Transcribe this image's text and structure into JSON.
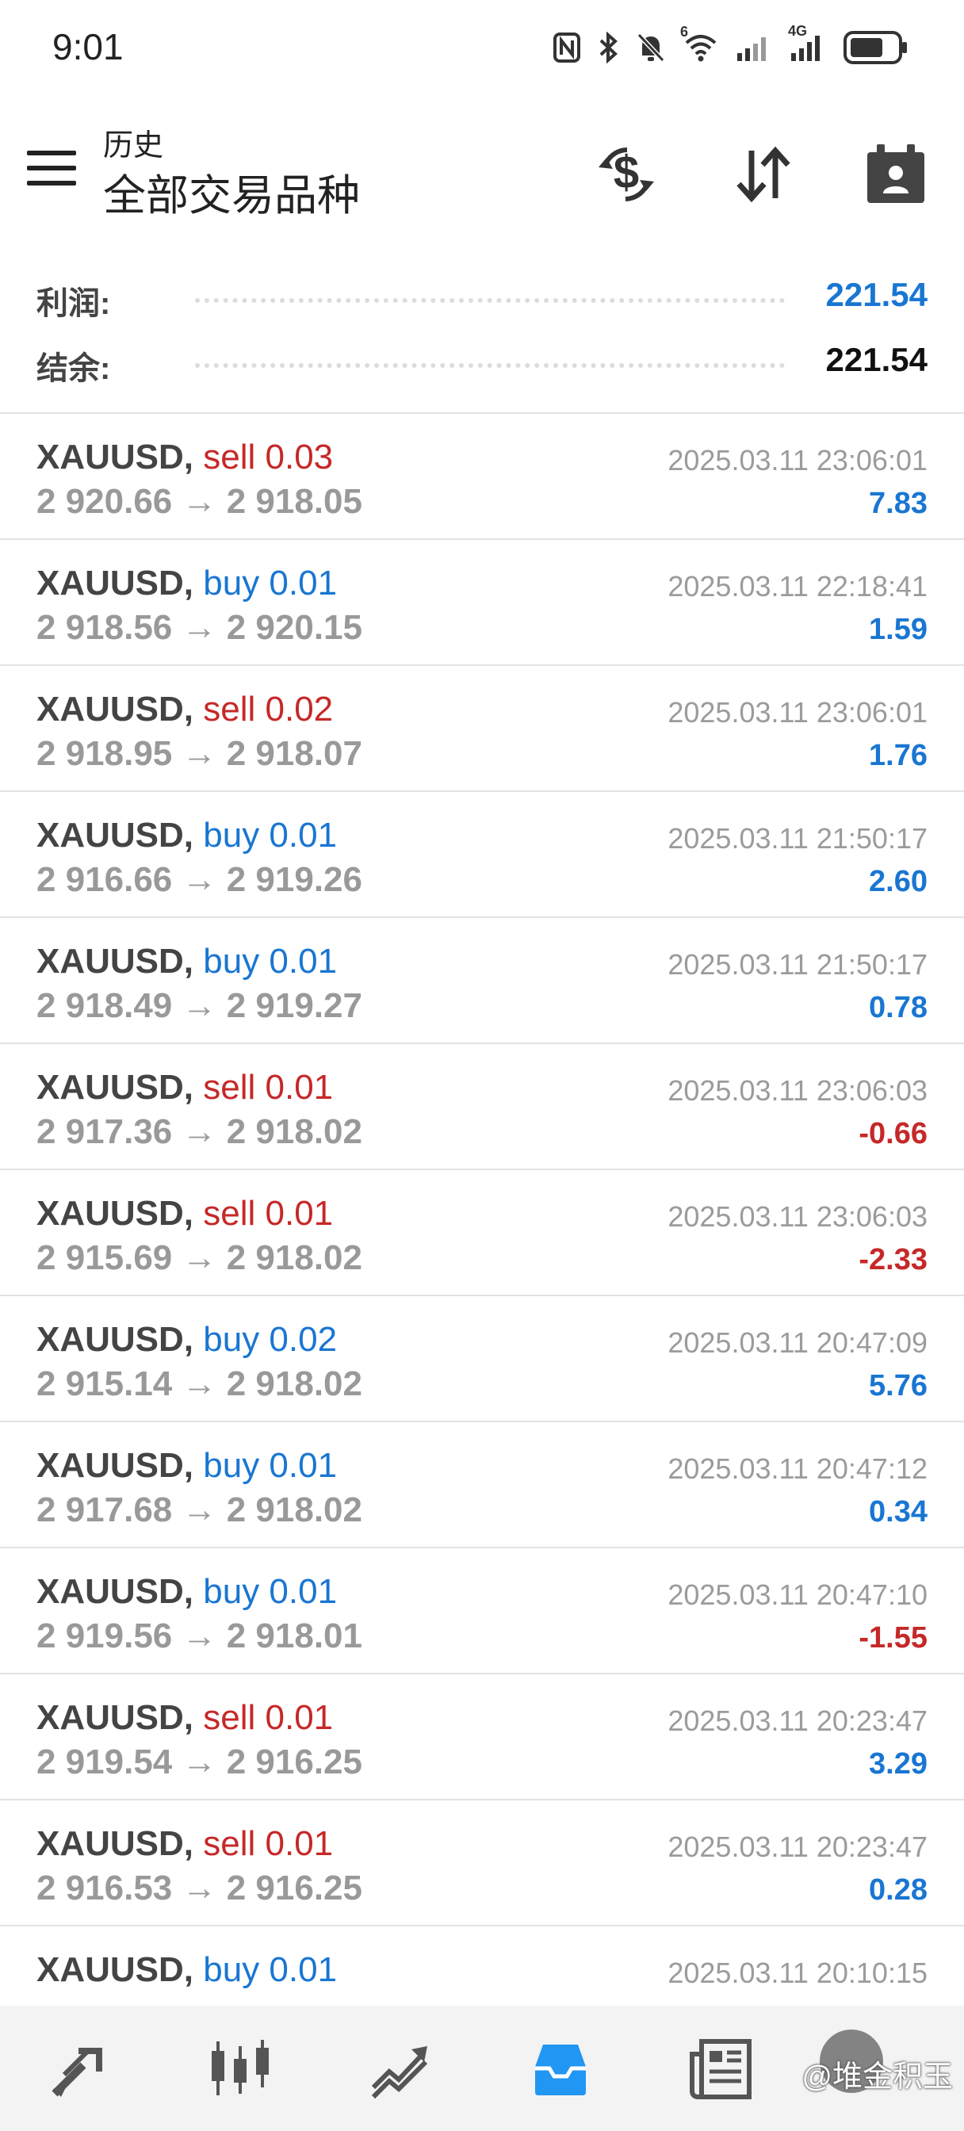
{
  "status_bar": {
    "time": "9:01",
    "icons": [
      "nfc-icon",
      "bluetooth-icon",
      "mute-icon",
      "wifi-icon",
      "signal-icon",
      "signal-4g-icon",
      "battery-icon"
    ],
    "wifi_label": "6",
    "network_label": "4G"
  },
  "header": {
    "subtitle": "历史",
    "title": "全部交易品种",
    "icons": [
      "menu-icon",
      "deposit-icon",
      "sort-icon",
      "calendar-icon"
    ]
  },
  "summary": {
    "profit_label": "利润:",
    "profit_value": "221.54",
    "balance_label": "结余:",
    "balance_value": "221.54"
  },
  "colors": {
    "buy": "#1976d2",
    "sell": "#c62828",
    "positive": "#1976d2",
    "negative": "#c62828",
    "accent_active": "#2196f3"
  },
  "trades": [
    {
      "symbol": "XAUUSD,",
      "side": "sell 0.03",
      "type": "sell",
      "prices": "2 920.66 → 2 918.05",
      "time": "2025.03.11 23:06:01",
      "profit": "7.83",
      "sign": "pos"
    },
    {
      "symbol": "XAUUSD,",
      "side": "buy 0.01",
      "type": "buy",
      "prices": "2 918.56 → 2 920.15",
      "time": "2025.03.11 22:18:41",
      "profit": "1.59",
      "sign": "pos"
    },
    {
      "symbol": "XAUUSD,",
      "side": "sell 0.02",
      "type": "sell",
      "prices": "2 918.95 → 2 918.07",
      "time": "2025.03.11 23:06:01",
      "profit": "1.76",
      "sign": "pos"
    },
    {
      "symbol": "XAUUSD,",
      "side": "buy 0.01",
      "type": "buy",
      "prices": "2 916.66 → 2 919.26",
      "time": "2025.03.11 21:50:17",
      "profit": "2.60",
      "sign": "pos"
    },
    {
      "symbol": "XAUUSD,",
      "side": "buy 0.01",
      "type": "buy",
      "prices": "2 918.49 → 2 919.27",
      "time": "2025.03.11 21:50:17",
      "profit": "0.78",
      "sign": "pos"
    },
    {
      "symbol": "XAUUSD,",
      "side": "sell 0.01",
      "type": "sell",
      "prices": "2 917.36 → 2 918.02",
      "time": "2025.03.11 23:06:03",
      "profit": "-0.66",
      "sign": "neg"
    },
    {
      "symbol": "XAUUSD,",
      "side": "sell 0.01",
      "type": "sell",
      "prices": "2 915.69 → 2 918.02",
      "time": "2025.03.11 23:06:03",
      "profit": "-2.33",
      "sign": "neg"
    },
    {
      "symbol": "XAUUSD,",
      "side": "buy 0.02",
      "type": "buy",
      "prices": "2 915.14 → 2 918.02",
      "time": "2025.03.11 20:47:09",
      "profit": "5.76",
      "sign": "pos"
    },
    {
      "symbol": "XAUUSD,",
      "side": "buy 0.01",
      "type": "buy",
      "prices": "2 917.68 → 2 918.02",
      "time": "2025.03.11 20:47:12",
      "profit": "0.34",
      "sign": "pos"
    },
    {
      "symbol": "XAUUSD,",
      "side": "buy 0.01",
      "type": "buy",
      "prices": "2 919.56 → 2 918.01",
      "time": "2025.03.11 20:47:10",
      "profit": "-1.55",
      "sign": "neg"
    },
    {
      "symbol": "XAUUSD,",
      "side": "sell 0.01",
      "type": "sell",
      "prices": "2 919.54 → 2 916.25",
      "time": "2025.03.11 20:23:47",
      "profit": "3.29",
      "sign": "pos"
    },
    {
      "symbol": "XAUUSD,",
      "side": "sell 0.01",
      "type": "sell",
      "prices": "2 916.53 → 2 916.25",
      "time": "2025.03.11 20:23:47",
      "profit": "0.28",
      "sign": "pos"
    },
    {
      "symbol": "XAUUSD,",
      "side": "buy 0.01",
      "type": "buy",
      "prices": "",
      "time": "2025.03.11 20:10:15",
      "profit": "",
      "sign": "pos"
    }
  ],
  "bottom_nav": {
    "items": [
      "quotes-icon",
      "chart-icon",
      "trade-icon",
      "history-icon",
      "news-icon"
    ],
    "active": "history-icon",
    "watermark": "@堆金积玉"
  }
}
